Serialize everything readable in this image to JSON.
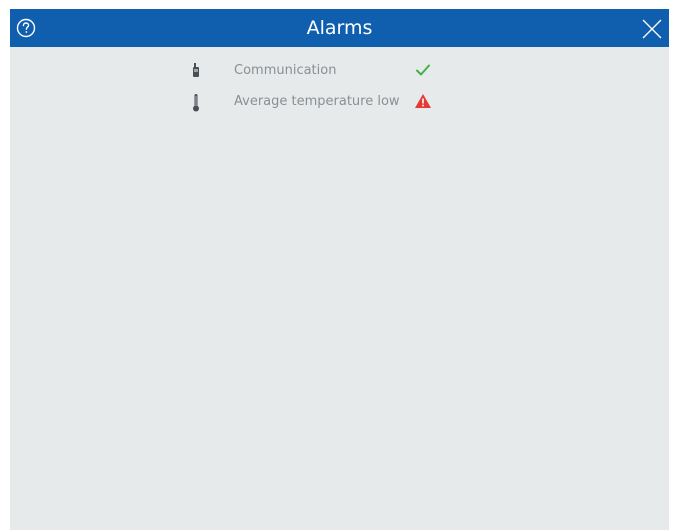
{
  "dialog": {
    "title": "Alarms"
  },
  "alarms": [
    {
      "label": "Communication",
      "icon": "mobile-device-icon",
      "status": "ok",
      "status_icon": "checkmark-icon",
      "status_color": "#44b04a"
    },
    {
      "label": "Average temperature low",
      "icon": "thermometer-icon",
      "status": "warning",
      "status_icon": "warning-triangle-icon",
      "status_color": "#e53935"
    }
  ],
  "colors": {
    "titlebar": "#0f5fae",
    "background": "#e6eaeb",
    "label_text": "#8a8f93"
  }
}
